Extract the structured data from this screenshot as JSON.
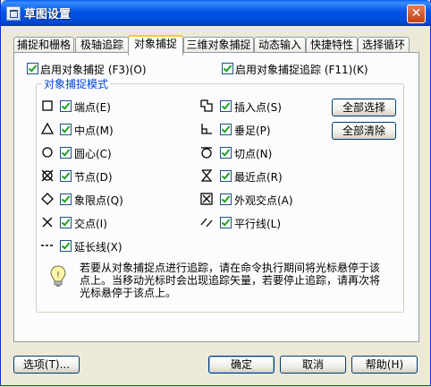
{
  "window": {
    "title": "草图设置"
  },
  "tabs": [
    {
      "label": "捕捉和栅格"
    },
    {
      "label": "极轴追踪"
    },
    {
      "label": "对象捕捉"
    },
    {
      "label": "三维对象捕捉"
    },
    {
      "label": "动态输入"
    },
    {
      "label": "快捷特性"
    },
    {
      "label": "选择循环"
    }
  ],
  "options": {
    "enable_snap": {
      "label": "启用对象捕捉 (F3)(O)",
      "checked": true
    },
    "enable_tracking": {
      "label": "启用对象捕捉追踪 (F11)(K)",
      "checked": true
    }
  },
  "group": {
    "title": "对象捕捉模式",
    "left_modes": [
      {
        "symbol": "square",
        "label": "端点(E)",
        "checked": true
      },
      {
        "symbol": "triangle",
        "label": "中点(M)",
        "checked": true
      },
      {
        "symbol": "circle",
        "label": "圆心(C)",
        "checked": true
      },
      {
        "symbol": "node",
        "label": "节点(D)",
        "checked": true
      },
      {
        "symbol": "diamond",
        "label": "象限点(Q)",
        "checked": true
      },
      {
        "symbol": "cross",
        "label": "交点(I)",
        "checked": true
      },
      {
        "symbol": "extension",
        "label": "延长线(X)",
        "checked": true
      }
    ],
    "right_modes": [
      {
        "symbol": "insertion",
        "label": "插入点(S)",
        "checked": true
      },
      {
        "symbol": "perpendicular",
        "label": "垂足(P)",
        "checked": true
      },
      {
        "symbol": "tangent",
        "label": "切点(N)",
        "checked": true
      },
      {
        "symbol": "nearest",
        "label": "最近点(R)",
        "checked": true
      },
      {
        "symbol": "apparent",
        "label": "外观交点(A)",
        "checked": true
      },
      {
        "symbol": "parallel",
        "label": "平行线(L)",
        "checked": true
      }
    ],
    "select_all": "全部选择",
    "clear_all": "全部清除"
  },
  "info": {
    "text": "若要从对象捕捉点进行追踪，请在命令执行期间将光标悬停于该点上。当移动光标时会出现追踪矢量，若要停止追踪，请再次将光标悬停于该点上。"
  },
  "buttons": {
    "options": "选项(T)...",
    "ok": "确定",
    "cancel": "取消",
    "help": "帮助(H)"
  }
}
